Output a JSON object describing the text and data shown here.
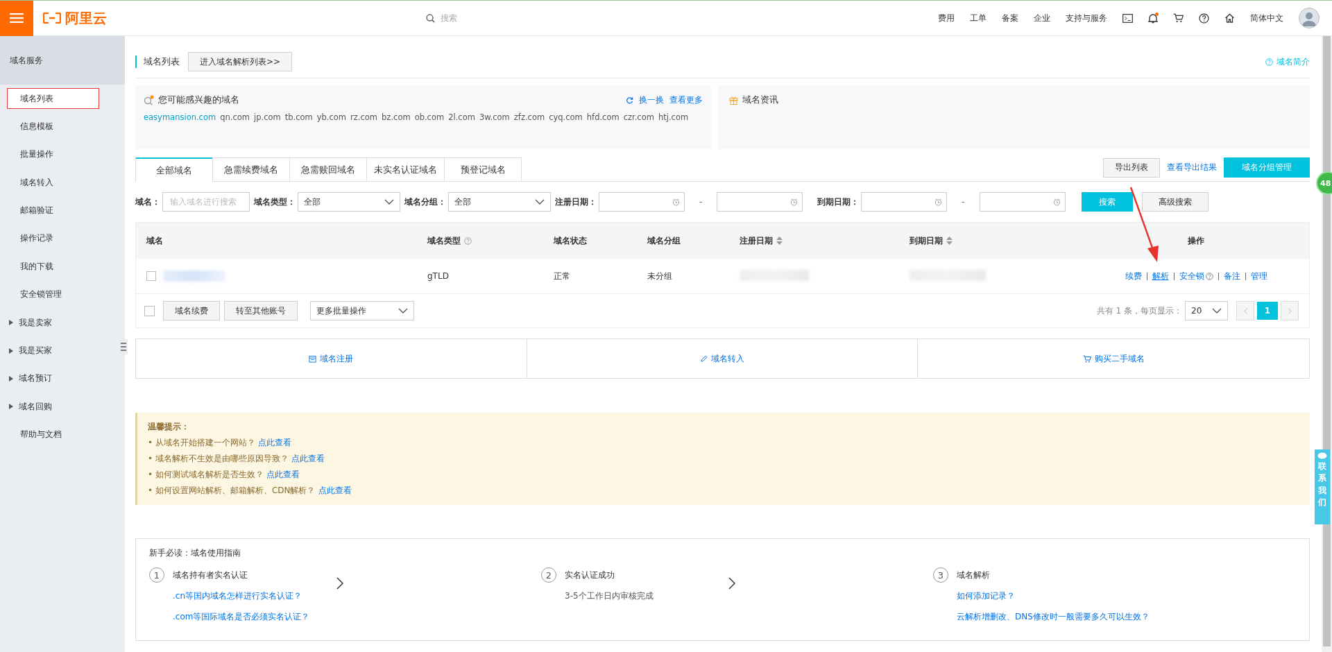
{
  "topbar": {
    "logo": "阿里云",
    "search_placeholder": "搜索",
    "nav": [
      "费用",
      "工单",
      "备案",
      "企业",
      "支持与服务"
    ],
    "notification_dot": true,
    "language": "简体中文"
  },
  "sidebar": {
    "title": "域名服务",
    "items": [
      {
        "label": "域名列表",
        "kind": "item",
        "selected": true
      },
      {
        "label": "信息模板",
        "kind": "item",
        "selected": false
      },
      {
        "label": "批量操作",
        "kind": "item",
        "selected": false
      },
      {
        "label": "域名转入",
        "kind": "item",
        "selected": false
      },
      {
        "label": "邮箱验证",
        "kind": "item",
        "selected": false
      },
      {
        "label": "操作记录",
        "kind": "item",
        "selected": false
      },
      {
        "label": "我的下载",
        "kind": "item",
        "selected": false
      },
      {
        "label": "安全锁管理",
        "kind": "item",
        "selected": false
      },
      {
        "label": "我是卖家",
        "kind": "group",
        "selected": false
      },
      {
        "label": "我是买家",
        "kind": "group",
        "selected": false
      },
      {
        "label": "域名预订",
        "kind": "group",
        "selected": false
      },
      {
        "label": "域名回购",
        "kind": "group",
        "selected": false
      },
      {
        "label": "帮助与文档",
        "kind": "item",
        "selected": false
      }
    ]
  },
  "header": {
    "title": "域名列表",
    "button": "进入域名解析列表>>",
    "help_link": "域名简介"
  },
  "interest": {
    "title": "您可能感兴趣的域名",
    "refresh": "换一换",
    "more": "查看更多",
    "domains": [
      {
        "name": "easymansion.com",
        "featured": true
      },
      {
        "name": "qn.com",
        "featured": false
      },
      {
        "name": "jp.com",
        "featured": false
      },
      {
        "name": "tb.com",
        "featured": false
      },
      {
        "name": "yb.com",
        "featured": false
      },
      {
        "name": "rz.com",
        "featured": false
      },
      {
        "name": "bz.com",
        "featured": false
      },
      {
        "name": "ob.com",
        "featured": false
      },
      {
        "name": "2l.com",
        "featured": false
      },
      {
        "name": "3w.com",
        "featured": false
      },
      {
        "name": "zfz.com",
        "featured": false
      },
      {
        "name": "cyq.com",
        "featured": false
      },
      {
        "name": "hfd.com",
        "featured": false
      },
      {
        "name": "czr.com",
        "featured": false
      },
      {
        "name": "htj.com",
        "featured": false
      }
    ]
  },
  "news": {
    "title": "域名资讯"
  },
  "tabs": [
    {
      "label": "全部域名",
      "selected": true
    },
    {
      "label": "急需续费域名",
      "selected": false
    },
    {
      "label": "急需赎回域名",
      "selected": false
    },
    {
      "label": "未实名认证域名",
      "selected": false
    },
    {
      "label": "预登记域名",
      "selected": false
    }
  ],
  "tab_actions": {
    "export": "导出列表",
    "view_export": "查看导出结果",
    "group_manage": "域名分组管理"
  },
  "filters": {
    "domain_label": "域名：",
    "domain_placeholder": "输入域名进行搜索",
    "type_label": "域名类型：",
    "type_value": "全部",
    "group_label": "域名分组：",
    "group_value": "全部",
    "reg_label": "注册日期：",
    "exp_label": "到期日期：",
    "range_sep": "-",
    "search": "搜索",
    "advanced": "高级搜索"
  },
  "table": {
    "columns": [
      {
        "label": "域名",
        "help": false,
        "sortable": false
      },
      {
        "label": "域名类型",
        "help": true,
        "sortable": false
      },
      {
        "label": "域名状态",
        "help": false,
        "sortable": false
      },
      {
        "label": "域名分组",
        "help": false,
        "sortable": false
      },
      {
        "label": "注册日期",
        "help": false,
        "sortable": true
      },
      {
        "label": "到期日期",
        "help": false,
        "sortable": true
      },
      {
        "label": "操作",
        "help": false,
        "sortable": false
      }
    ],
    "rows": [
      {
        "checked": false,
        "domain_type": "gTLD",
        "status": "正常",
        "group": "未分组",
        "actions": [
          {
            "label": "续费",
            "help": false,
            "hovered": false
          },
          {
            "label": "解析",
            "help": false,
            "hovered": true
          },
          {
            "label": "安全锁",
            "help": true,
            "hovered": false
          },
          {
            "label": "备注",
            "help": false,
            "hovered": false
          },
          {
            "label": "管理",
            "help": false,
            "hovered": false
          }
        ]
      }
    ]
  },
  "bulk": {
    "checked": false,
    "buttons": [
      "域名续费",
      "转至其他账号"
    ],
    "more": "更多批量操作"
  },
  "pagination": {
    "summary": "共有 1 条，每页显示：",
    "page_size": "20",
    "pages": [
      {
        "label": "1",
        "selected": true
      }
    ]
  },
  "quick_links": [
    {
      "label": "域名注册",
      "kind": "register"
    },
    {
      "label": "域名转入",
      "kind": "transfer"
    },
    {
      "label": "购买二手域名",
      "kind": "buy"
    }
  ],
  "tips": {
    "title": "温馨提示：",
    "items": [
      {
        "text": "• 从域名开始搭建一个网站？",
        "link": "点此查看"
      },
      {
        "text": "• 域名解析不生效是由哪些原因导致？",
        "link": "点此查看"
      },
      {
        "text": "• 如何测试域名解析是否生效？",
        "link": "点此查看"
      },
      {
        "text": "• 如何设置网站解析、邮箱解析、CDN解析？",
        "link": "点此查看"
      }
    ]
  },
  "guide": {
    "title": "新手必读：域名使用指南",
    "steps": [
      {
        "number": "1",
        "title": "域名持有者实名认证",
        "items": [
          {
            "text": ".cn等国内域名怎样进行实名认证？",
            "kind": "link"
          },
          {
            "text": ".com等国际域名是否必须实名认证？",
            "kind": "link"
          }
        ]
      },
      {
        "number": "2",
        "title": "实名认证成功",
        "items": [
          {
            "text": "3-5个工作日内审核完成",
            "kind": "text"
          }
        ]
      },
      {
        "number": "3",
        "title": "域名解析",
        "items": [
          {
            "text": "如何添加记录？",
            "kind": "link"
          },
          {
            "text": "云解析增删改、DNS修改时一般需要多久可以生效？",
            "kind": "link"
          }
        ]
      }
    ]
  },
  "floating": {
    "badge": "48",
    "contact": "联系我们"
  }
}
